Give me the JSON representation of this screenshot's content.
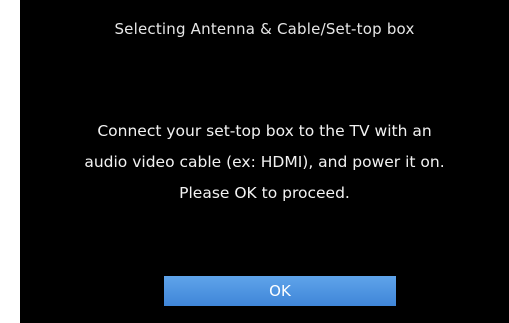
{
  "dialog": {
    "title": "Selecting Antenna & Cable/Set-top box",
    "message_lines": [
      "Connect your set-top box to the TV with an",
      "audio video cable (ex: HDMI), and power it on.",
      "Please OK to proceed."
    ],
    "ok_label": "OK"
  },
  "colors": {
    "background": "#000000",
    "text": "#f2f2f2",
    "button": "#4a91df",
    "button_text": "#ffffff"
  }
}
